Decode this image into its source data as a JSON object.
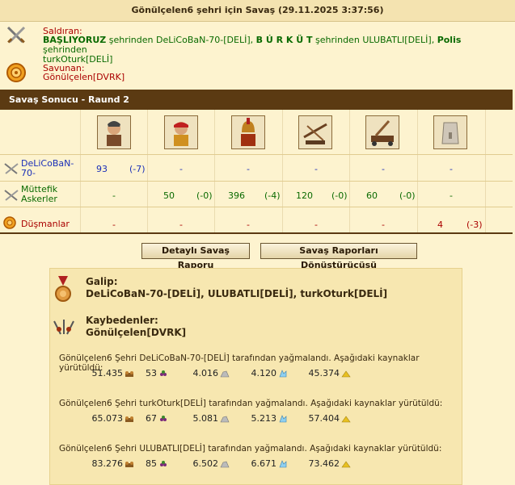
{
  "title": "Gönülçelen6 şehri için Savaş (29.11.2025 3:37:56)",
  "attacker": {
    "label": "Saldıran:",
    "segments": [
      {
        "text": "BAŞLIYORUZ",
        "bold": true
      },
      {
        "text": " şehrinden ",
        "bold": false
      },
      {
        "text": "DeLiCoBaN-70-[DELİ]",
        "bold": false
      },
      {
        "text": ", ",
        "bold": false
      },
      {
        "text": "B Ú R K Ü T",
        "bold": true
      },
      {
        "text": " şehrinden ",
        "bold": false
      },
      {
        "text": "ULUBATLI[DELİ]",
        "bold": false
      },
      {
        "text": ", ",
        "bold": false
      },
      {
        "text": "Polis",
        "bold": true
      },
      {
        "text": " şehrinden",
        "bold": false
      }
    ],
    "second_line": "turkOturk[DELİ]"
  },
  "defender": {
    "label": "Savunan:",
    "name": "Gönülçelen[DVRK]"
  },
  "result_title": "Savaş Sonucu - Raund 2",
  "units": [
    "swordsman-unit-icon",
    "archer-unit-icon",
    "spartan-hoplite-unit-icon",
    "ballista-unit-icon",
    "catapult-unit-icon",
    "wall-unit-icon"
  ],
  "rows": [
    {
      "label": "DeLiCoBaN-70-",
      "label_color": "blue",
      "cells": [
        {
          "value": "93",
          "delta": "(-7)"
        },
        {
          "value": "-",
          "delta": ""
        },
        {
          "value": "-",
          "delta": ""
        },
        {
          "value": "-",
          "delta": ""
        },
        {
          "value": "-",
          "delta": ""
        },
        {
          "value": "-",
          "delta": ""
        }
      ]
    },
    {
      "label": "Müttefik Askerler",
      "label_color": "green",
      "cells": [
        {
          "value": "-",
          "delta": ""
        },
        {
          "value": "50",
          "delta": "(-0)"
        },
        {
          "value": "396",
          "delta": "(-4)"
        },
        {
          "value": "120",
          "delta": "(-0)"
        },
        {
          "value": "60",
          "delta": "(-0)"
        },
        {
          "value": "-",
          "delta": ""
        }
      ]
    },
    {
      "label": "Düşmanlar",
      "label_color": "red",
      "cells": [
        {
          "value": "-",
          "delta": ""
        },
        {
          "value": "-",
          "delta": ""
        },
        {
          "value": "-",
          "delta": ""
        },
        {
          "value": "-",
          "delta": ""
        },
        {
          "value": "-",
          "delta": ""
        },
        {
          "value": "4",
          "delta": "(-3)"
        }
      ]
    }
  ],
  "buttons": {
    "detailed_report": "Detaylı Savaş Raporu",
    "converter": "Savaş Raporları Dönüştürücüsü"
  },
  "summary": {
    "winner_label": "Galip:",
    "winner_names": "DeLiCoBaN-70-[DELİ], ULUBATLI[DELİ], turkOturk[DELİ]",
    "loser_label": "Kaybedenler:",
    "loser_names": "Gönülçelen[DVRK]",
    "loot": [
      {
        "text": "Gönülçelen6 Şehri DeLiCoBaN-70-[DELİ] tarafından yağmalandı. Aşağıdaki kaynaklar yürütüldü:",
        "values": [
          "51.435",
          "53",
          "4.016",
          "4.120",
          "45.374"
        ]
      },
      {
        "text": "Gönülçelen6 Şehri turkOturk[DELİ] tarafından yağmalandı. Aşağıdaki kaynaklar yürütüldü:",
        "values": [
          "65.073",
          "67",
          "5.081",
          "5.213",
          "57.404"
        ]
      },
      {
        "text": "Gönülçelen6 Şehri ULUBATLI[DELİ] tarafından yağmalandı. Aşağıdaki kaynaklar yürütüldü:",
        "values": [
          "83.276",
          "85",
          "6.502",
          "6.671",
          "73.462"
        ]
      }
    ],
    "resource_icons": [
      "wood-icon",
      "wine-icon",
      "marble-icon",
      "crystal-icon",
      "sulfur-icon"
    ]
  },
  "colors": {
    "header_brown": "#5b3a12",
    "background": "#fdf3cf",
    "blue": "#1a2fb8",
    "green": "#0a6a00",
    "red": "#aa0000"
  }
}
